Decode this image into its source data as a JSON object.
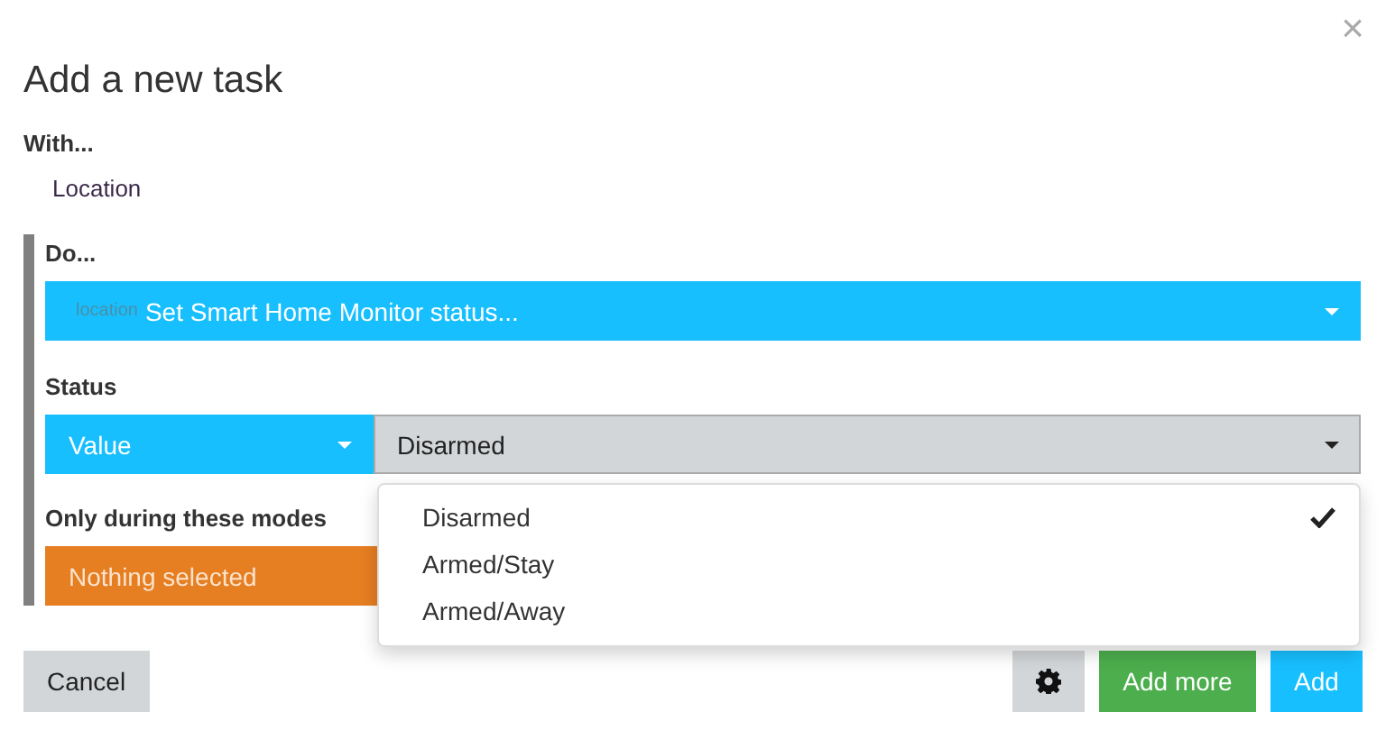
{
  "dialog": {
    "close": "×",
    "title": "Add a new task"
  },
  "with": {
    "label": "With...",
    "device": "Location"
  },
  "do": {
    "label": "Do...",
    "prefix": "location",
    "action": "Set Smart Home Monitor status..."
  },
  "status": {
    "label": "Status",
    "type": "Value",
    "value": "Disarmed",
    "options": [
      {
        "label": "Disarmed",
        "selected": true
      },
      {
        "label": "Armed/Stay",
        "selected": false
      },
      {
        "label": "Armed/Away",
        "selected": false
      }
    ]
  },
  "modes": {
    "label": "Only during these modes",
    "text": "Nothing selected"
  },
  "buttons": [
    {
      "kind": "cancel",
      "label": "Cancel"
    },
    {
      "kind": "settings"
    },
    {
      "kind": "add_more",
      "label": "Add more"
    },
    {
      "kind": "add",
      "label": "Add"
    }
  ]
}
